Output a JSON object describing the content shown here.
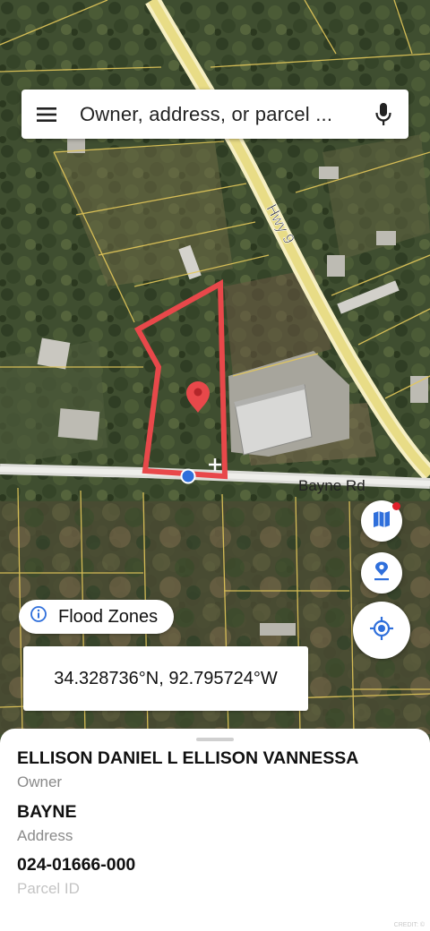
{
  "search": {
    "placeholder": "Owner, address, or parcel ...",
    "menu_icon": "menu-icon",
    "mic_icon": "mic-icon"
  },
  "map": {
    "road_labels": [
      "Hwy 9",
      "Bayne Rd"
    ],
    "parcel_outline_color": "#e8484a",
    "pin_color": "#e8484a",
    "location_dot_color": "#2f6fdb"
  },
  "controls": {
    "layers_icon": "map-layers-icon",
    "pin_icon": "location-pin-icon",
    "locate_icon": "my-location-icon",
    "accent": "#2f6fdb"
  },
  "flood_chip": {
    "label": "Flood Zones",
    "icon": "info-icon"
  },
  "coordinates": {
    "text": "34.328736°N, 92.795724°W"
  },
  "parcel": {
    "owner": "ELLISON DANIEL L ELLISON VANNESSA",
    "owner_label": "Owner",
    "address": "BAYNE",
    "address_label": "Address",
    "parcel_id": "024-01666-000",
    "parcel_id_label": "Parcel ID"
  },
  "watermark": "CREDIT: ©"
}
